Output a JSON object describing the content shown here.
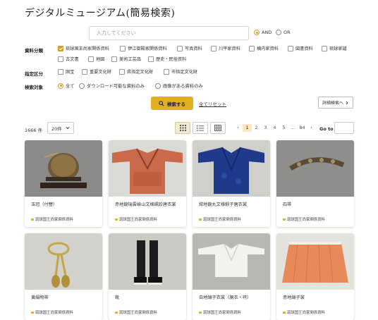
{
  "page_title": "デジタルミュージアム(簡易検索)",
  "search": {
    "placeholder": "入力してください",
    "value": "",
    "op_and": "AND",
    "op_or": "OR",
    "selected_op": "AND"
  },
  "filters": {
    "category_label": "資料分類",
    "categories": [
      {
        "label": "琉球国王尚家関係資料",
        "checked": true
      },
      {
        "label": "伊江御殿家関係資料",
        "checked": false
      },
      {
        "label": "写真資料",
        "checked": false
      },
      {
        "label": "川平家資料",
        "checked": false
      },
      {
        "label": "横内家資料",
        "checked": false
      },
      {
        "label": "図書資料",
        "checked": false
      },
      {
        "label": "琉球家譜",
        "checked": false
      },
      {
        "label": "古文書",
        "checked": false
      },
      {
        "label": "地図",
        "checked": false
      },
      {
        "label": "美術工芸品",
        "checked": false
      },
      {
        "label": "歴史・民俗資料",
        "checked": false
      }
    ],
    "designation_label": "指定区分",
    "designations": [
      {
        "label": "国宝",
        "checked": false
      },
      {
        "label": "重要文化財",
        "checked": false
      },
      {
        "label": "県指定文化財",
        "checked": false
      },
      {
        "label": "市指定文化財",
        "checked": false
      }
    ],
    "target_label": "検索対象",
    "targets": [
      {
        "label": "全て",
        "selected": true
      },
      {
        "label": "ダウンロード可能な資料のみ",
        "selected": false
      },
      {
        "label": "画像がある資料のみ",
        "selected": false
      }
    ]
  },
  "actions": {
    "search_label": "検索する",
    "reset_label": "全てリセット",
    "detail_label": "詳細検索へ"
  },
  "results": {
    "count": "1666 件",
    "per_page": "20件",
    "pager": {
      "prev": "‹",
      "pages": [
        "1",
        "2",
        "3",
        "4",
        "5",
        "...",
        "84"
      ],
      "current": "1",
      "next": "›"
    },
    "goto_label": "Go to",
    "items": [
      {
        "name": "玉冠（付簪）",
        "collection": "琉球国王尚家関係資料"
      },
      {
        "name": "赤地龍瑞雲嶮山文様繻珍唐衣裳",
        "collection": "琉球国王尚家関係資料"
      },
      {
        "name": "紺地龍丸文様緞子唐衣裳",
        "collection": "琉球国王尚家関係資料"
      },
      {
        "name": "石帯",
        "collection": "琉球国王尚家関係資料"
      },
      {
        "name": "黄絹物帯",
        "collection": "琉球国王尚家関係資料"
      },
      {
        "name": "靴",
        "collection": "琉球国王尚家関係資料"
      },
      {
        "name": "白地縞子衣裳（胴衣・袴）",
        "collection": "琉球国王尚家関係資料"
      },
      {
        "name": "赤地縞子裳",
        "collection": "琉球国王尚家関係資料"
      }
    ]
  },
  "colors": {
    "accent": "#e0b020",
    "page_bg": "#ffffff"
  }
}
